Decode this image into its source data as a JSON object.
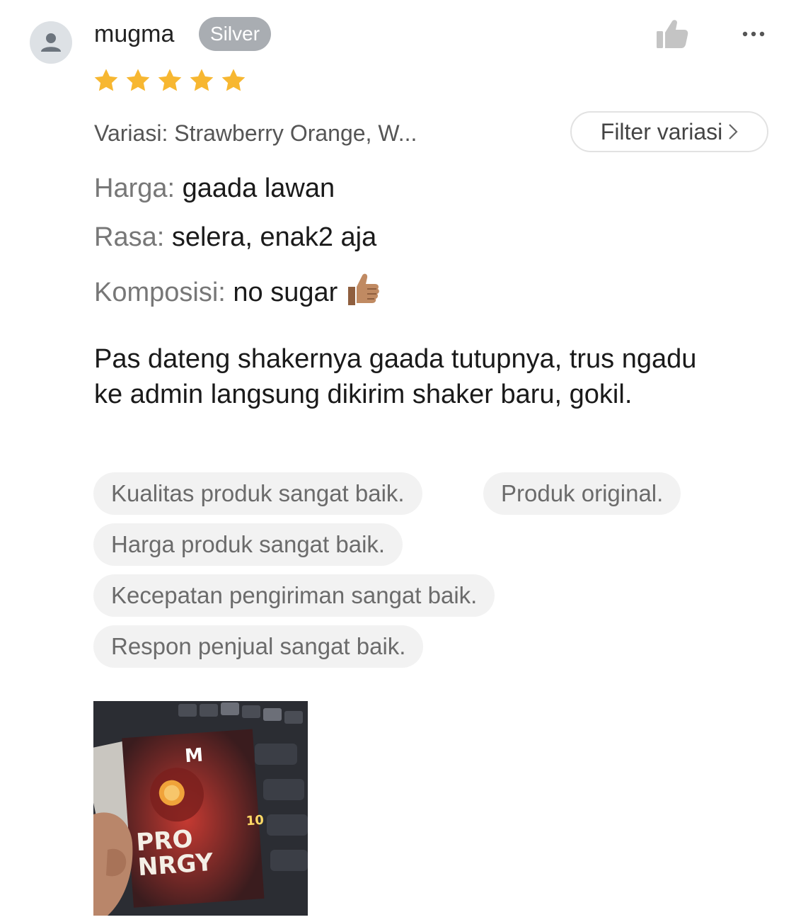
{
  "review": {
    "user": {
      "name": "mugma",
      "tier_badge": "Silver",
      "avatar_icon": "user-silhouette-icon"
    },
    "rating": {
      "value": 5,
      "max": 5,
      "star_color": "#f7b731"
    },
    "actions": {
      "like_icon": "thumbs-up-icon",
      "more_icon": "more-dots-icon"
    },
    "variation": {
      "text": "Variasi: Strawberry Orange, W...",
      "filter_label": "Filter variasi",
      "filter_icon": "chevron-right-icon"
    },
    "attributes": [
      {
        "key": "Harga:",
        "value": "gaada lawan"
      },
      {
        "key": "Rasa:",
        "value": "selera, enak2 aja"
      },
      {
        "key": "Komposisi:",
        "value": "no sugar"
      }
    ],
    "composition_emoji_icon": "thumbs-up-emoji-icon",
    "body": "Pas dateng shakernya gaada tutupnya, trus ngadu ke admin langsung dikirim shaker baru, gokil.",
    "tags": [
      "Kualitas produk sangat baik.",
      "Produk original.",
      "Harga produk sangat baik.",
      "Kecepatan pengiriman sangat baik.",
      "Respon penjual sangat baik."
    ],
    "photo": {
      "brand_lines": [
        "PRO",
        "NRGY"
      ],
      "count_label": "10"
    }
  }
}
